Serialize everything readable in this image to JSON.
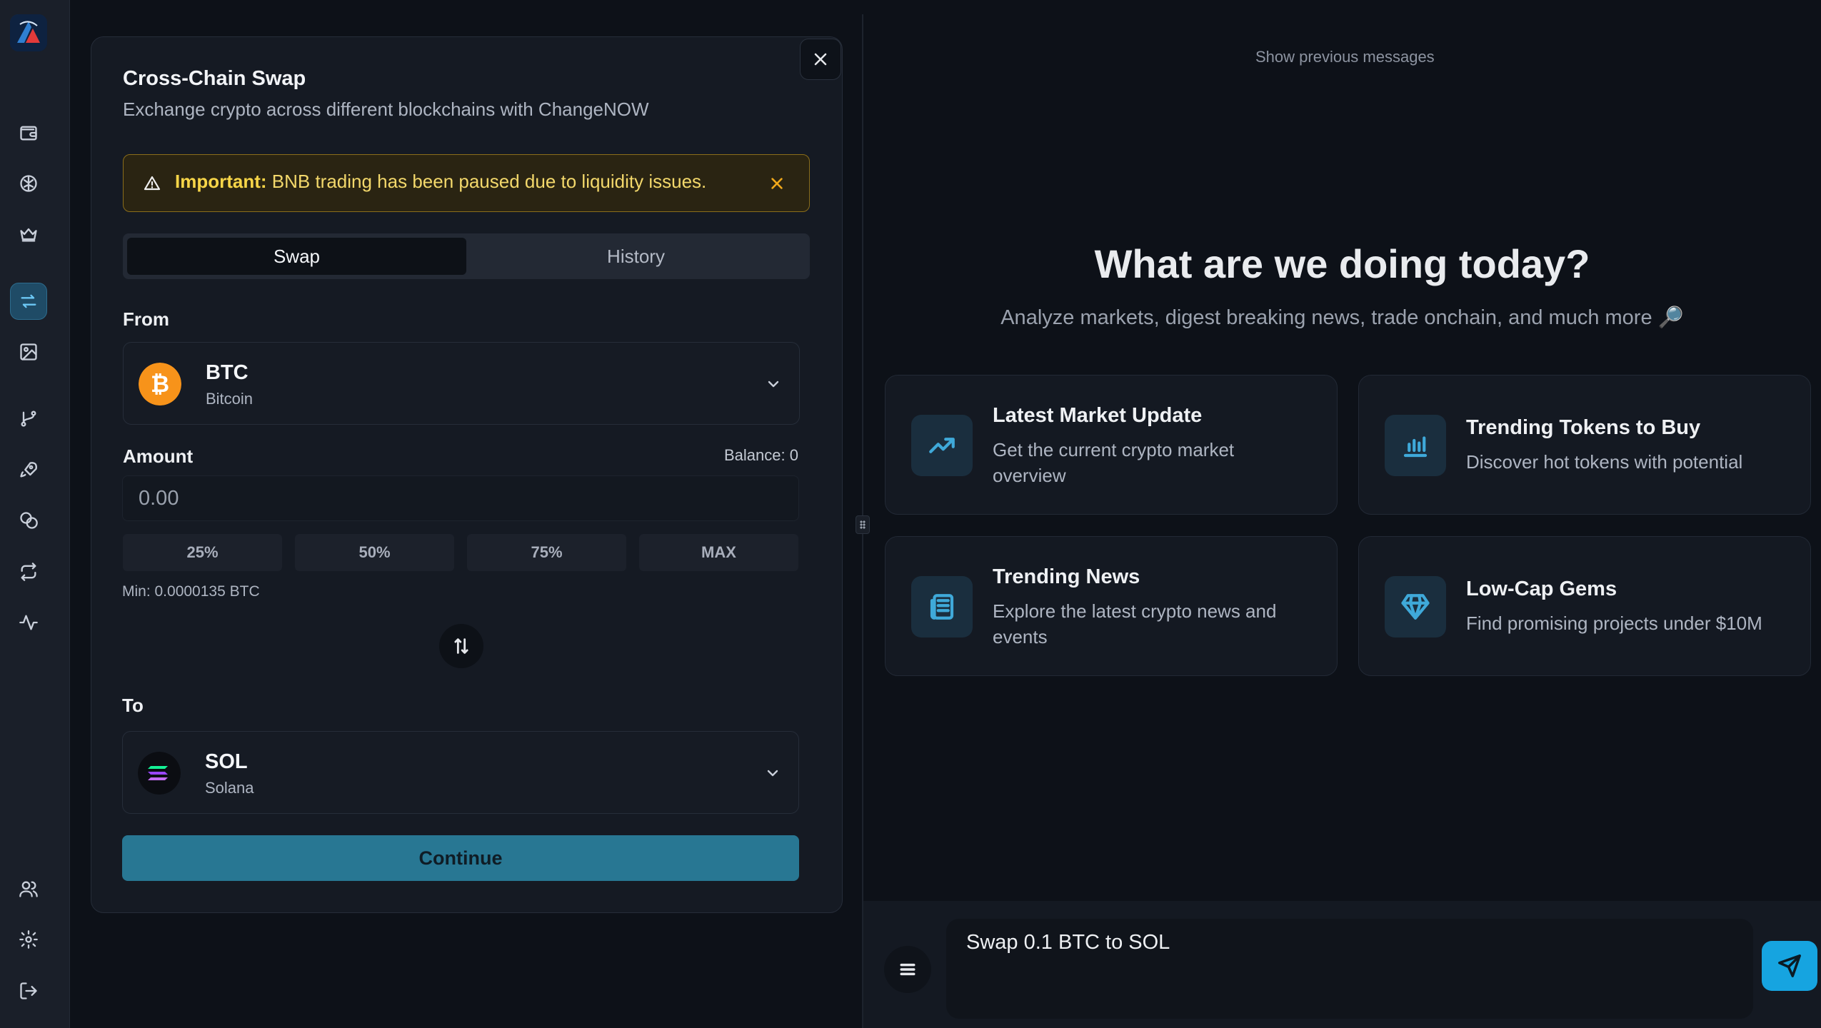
{
  "sidebar": {
    "items": [
      {
        "icon": "wallet-icon"
      },
      {
        "icon": "brain-icon"
      },
      {
        "icon": "crown-icon"
      },
      {
        "icon": "swap-arrows-icon",
        "active": true
      },
      {
        "icon": "image-icon"
      },
      {
        "icon": "git-branch-icon"
      },
      {
        "icon": "rocket-icon"
      },
      {
        "icon": "coins-icon"
      },
      {
        "icon": "repeat-icon"
      },
      {
        "icon": "activity-icon"
      },
      {
        "icon": "users-icon"
      },
      {
        "icon": "settings-icon"
      },
      {
        "icon": "logout-icon"
      }
    ]
  },
  "swap_panel": {
    "title": "Cross-Chain Swap",
    "subtitle": "Exchange crypto across different blockchains with ChangeNOW",
    "alert": {
      "strong": "Important:",
      "text": " BNB trading has been paused due to liquidity issues."
    },
    "tabs": {
      "swap": "Swap",
      "history": "History"
    },
    "from_label": "From",
    "from_coin": {
      "symbol": "BTC",
      "name": "Bitcoin"
    },
    "amount_label": "Amount",
    "balance": "Balance: 0",
    "amount_placeholder": "0.00",
    "percent_buttons": [
      "25%",
      "50%",
      "75%",
      "MAX"
    ],
    "min_text": "Min: 0.0000135 BTC",
    "to_label": "To",
    "to_coin": {
      "symbol": "SOL",
      "name": "Solana"
    },
    "continue_label": "Continue"
  },
  "chat": {
    "show_previous": "Show previous messages",
    "hero_title": "What are we doing today?",
    "hero_subtitle": "Analyze markets, digest breaking news, trade onchain, and much more 🔎",
    "cards": [
      {
        "title": "Latest Market Update",
        "desc": "Get the current crypto market overview",
        "icon": "trending-up-icon"
      },
      {
        "title": "Trending Tokens to Buy",
        "desc": "Discover hot tokens with potential",
        "icon": "bar-chart-icon"
      },
      {
        "title": "Trending News",
        "desc": "Explore the latest crypto news and events",
        "icon": "newspaper-icon"
      },
      {
        "title": "Low-Cap Gems",
        "desc": "Find promising projects under $10M",
        "icon": "gem-icon"
      }
    ],
    "composer_text": "Swap 0.1 BTC to SOL"
  },
  "colors": {
    "accent": "#16a4e0",
    "continue_button": "#287793",
    "alert_text": "#f7d548",
    "btc_orange": "#f7931a"
  }
}
